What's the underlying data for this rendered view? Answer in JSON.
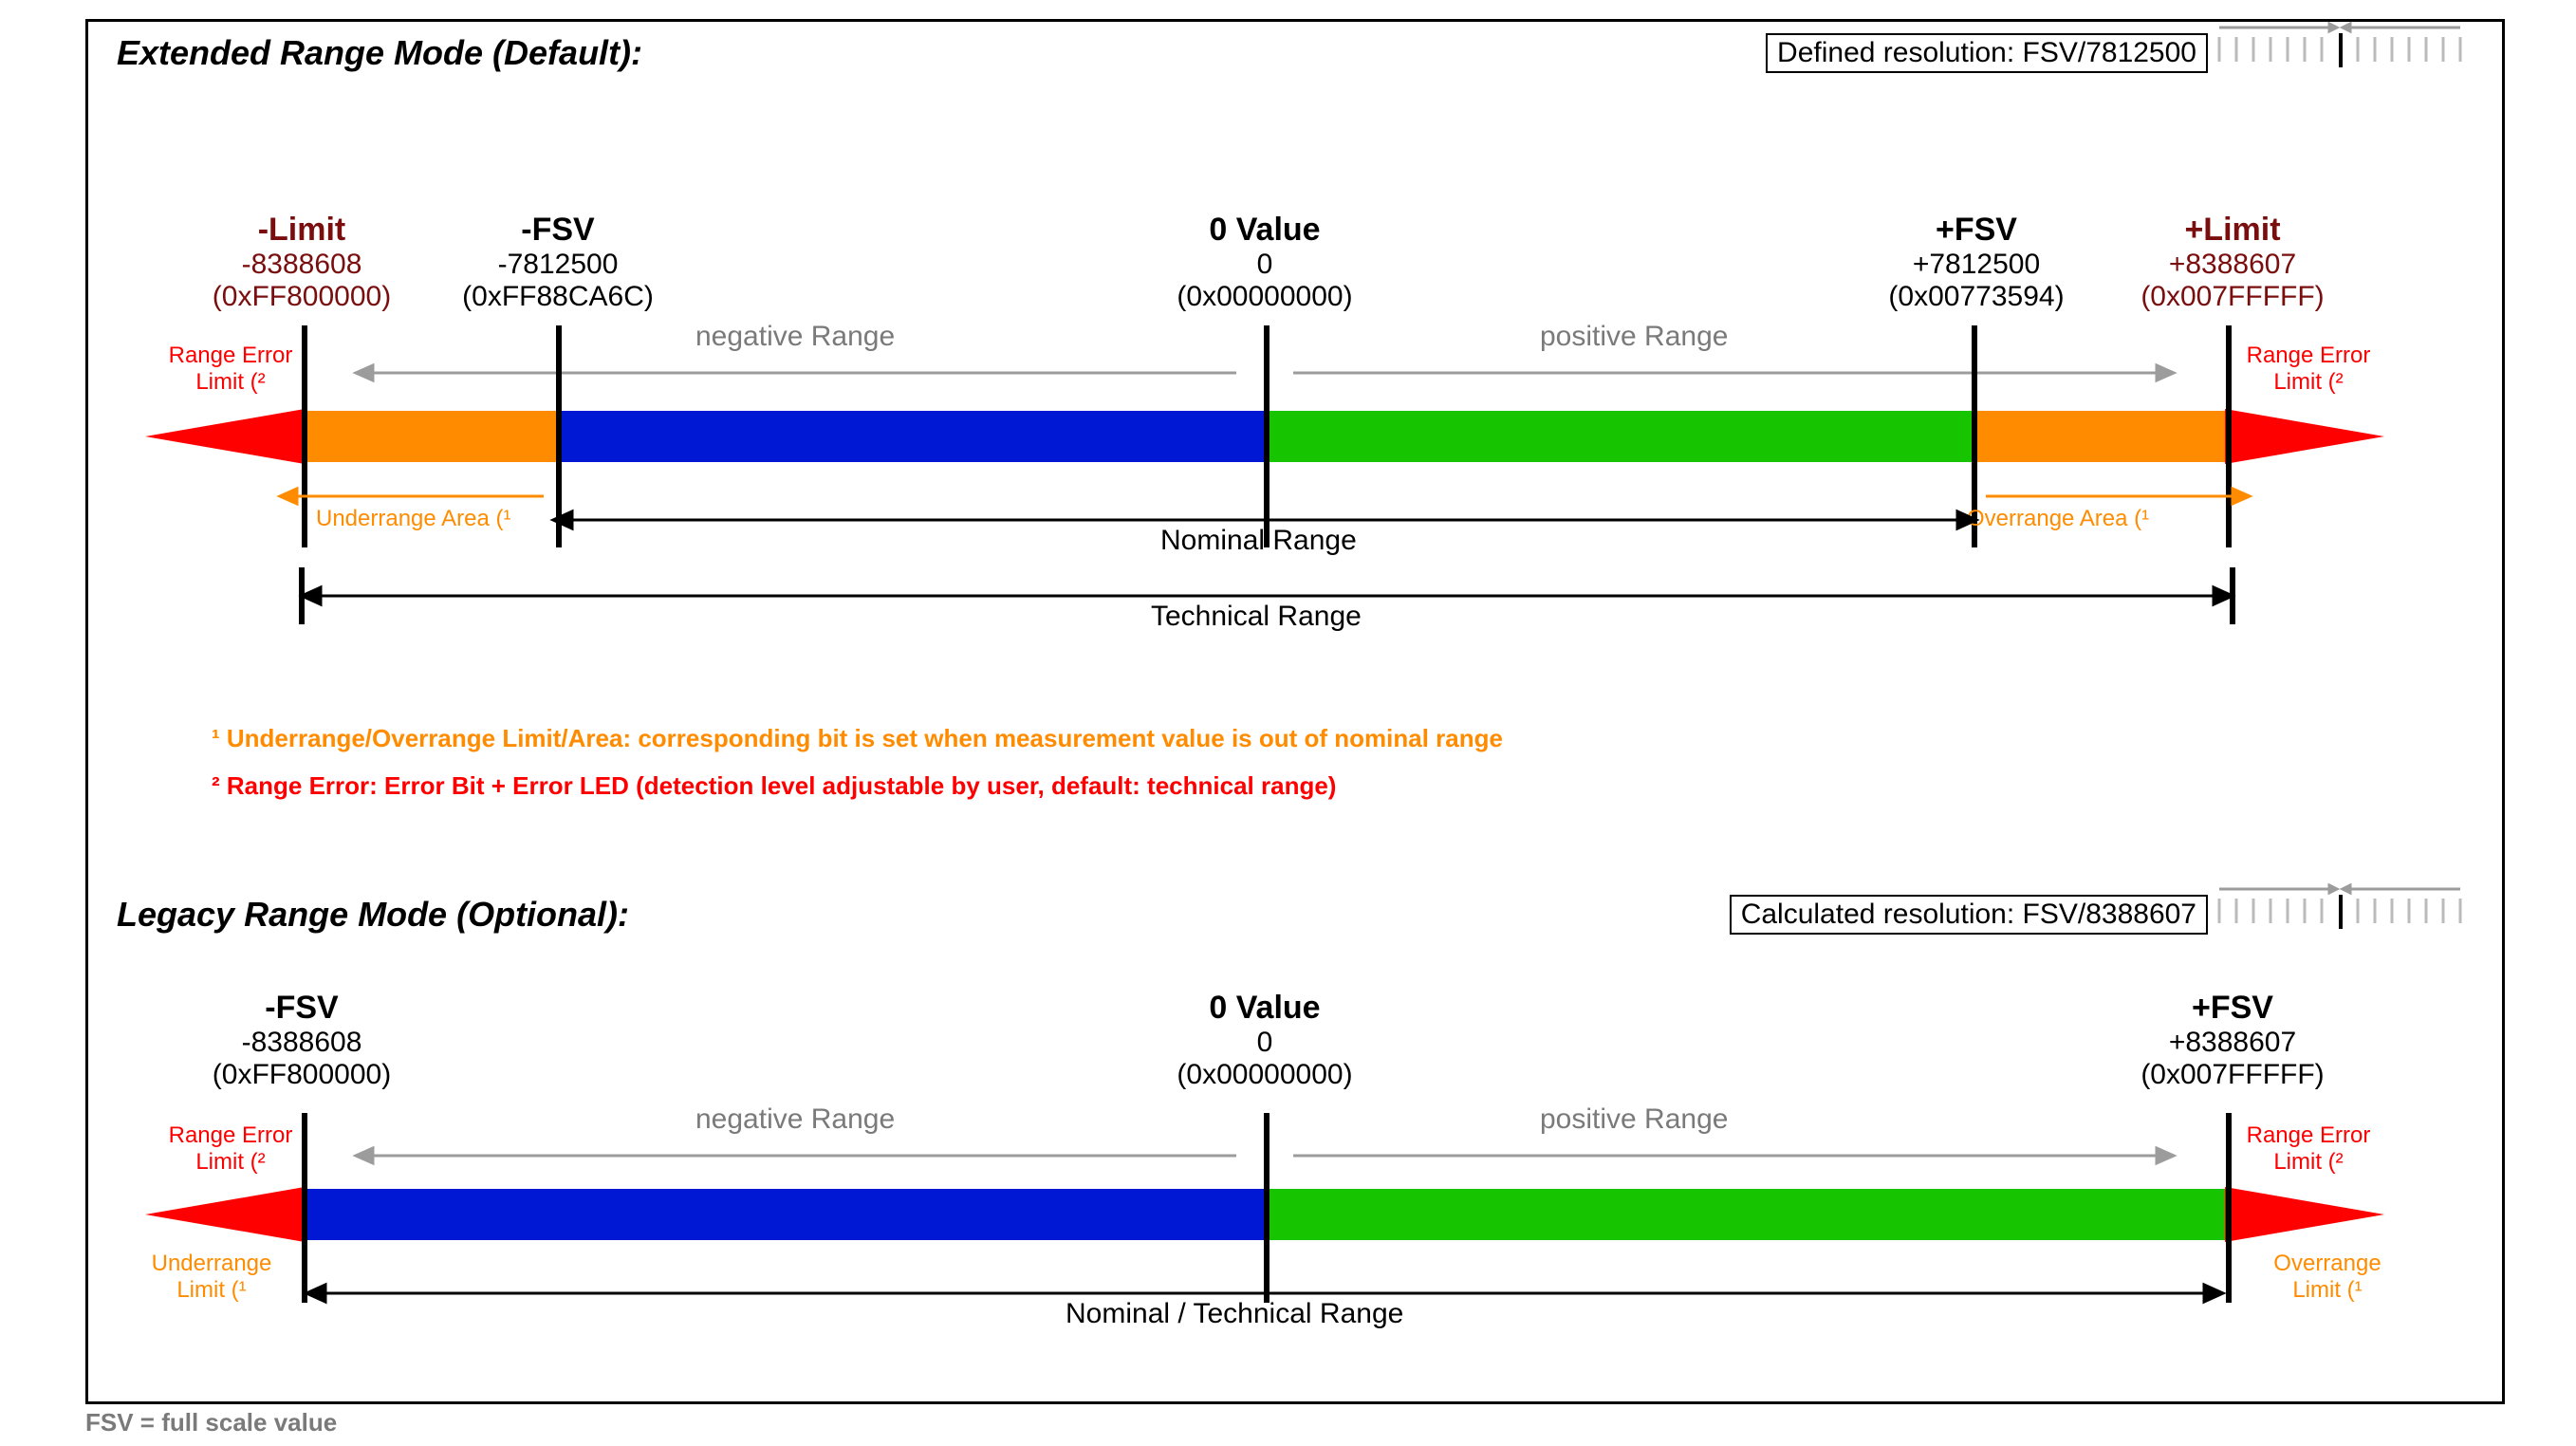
{
  "extended": {
    "title": "Extended Range Mode (Default):",
    "resolution": "Defined resolution:  FSV/7812500",
    "neg_limit": {
      "title": "-Limit",
      "val": "-8388608",
      "hex": "(0xFF800000)"
    },
    "neg_fsv": {
      "title": "-FSV",
      "val": "-7812500",
      "hex": "(0xFF88CA6C)"
    },
    "zero": {
      "title": "0 Value",
      "val": "0",
      "hex": "(0x00000000)"
    },
    "pos_fsv": {
      "title": "+FSV",
      "val": "+7812500",
      "hex": "(0x00773594)"
    },
    "pos_limit": {
      "title": "+Limit",
      "val": "+8388607",
      "hex": "(0x007FFFFF)"
    },
    "neg_range": "negative Range",
    "pos_range": "positive Range",
    "range_err_l": "Range Error",
    "range_err_l2": "Limit (²",
    "range_err_r": "Range Error",
    "range_err_r2": "Limit (²",
    "under": "Underrange Area (¹",
    "over": "Overrange Area (¹",
    "nominal": "Nominal Range",
    "technical": "Technical Range"
  },
  "legacy": {
    "title": "Legacy Range Mode (Optional):",
    "resolution": "Calculated resolution:  FSV/8388607",
    "neg_fsv": {
      "title": "-FSV",
      "val": "-8388608",
      "hex": "(0xFF800000)"
    },
    "zero": {
      "title": "0 Value",
      "val": "0",
      "hex": "(0x00000000)"
    },
    "pos_fsv": {
      "title": "+FSV",
      "val": "+8388607",
      "hex": "(0x007FFFFF)"
    },
    "neg_range": "negative Range",
    "pos_range": "positive Range",
    "range_err_l": "Range Error",
    "range_err_l2": "Limit (²",
    "range_err_r": "Range Error",
    "range_err_r2": "Limit (²",
    "under": "Underrange",
    "under2": "Limit (¹",
    "over": "Overrange",
    "over2": "Limit (¹",
    "nominal": "Nominal / Technical Range"
  },
  "fn1": "¹ Underrange/Overrange Limit/Area: corresponding bit is set when measurement value is out of nominal range",
  "fn2": "² Range Error: Error Bit + Error LED (detection level adjustable by user, default: technical range)",
  "fsv_note": "FSV = full scale value"
}
